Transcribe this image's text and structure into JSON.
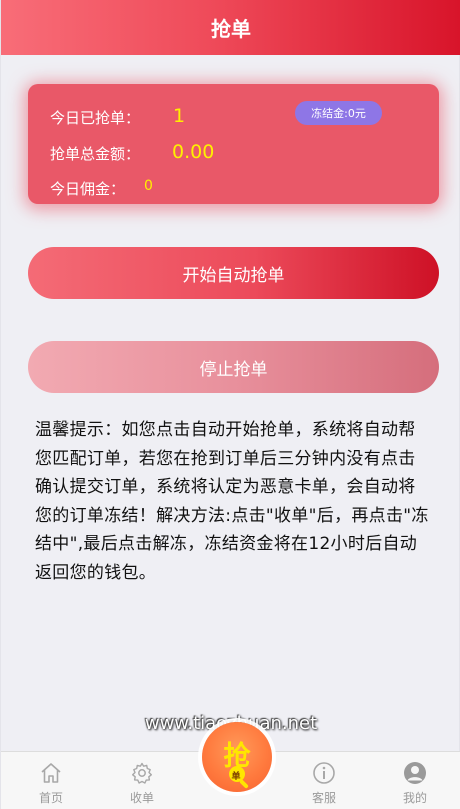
{
  "header": {
    "title": "抢单"
  },
  "stats": {
    "today_grabbed_label": "今日已抢单：",
    "today_grabbed_value": "1",
    "total_amount_label": "抢单总金额：",
    "total_amount_value": "0.00",
    "today_commission_label": "今日佣金：",
    "today_commission_value": "0",
    "frozen_badge": "冻结金:0元"
  },
  "buttons": {
    "start": "开始自动抢单",
    "stop": "停止抢单"
  },
  "tips": "温馨提示：如您点击自动开始抢单，系统将自动帮您匹配订单，若您在抢到订单后三分钟内没有点击确认提交订单，系统将认定为恶意卡单，会自动将您的订单冻结！解决方法:点击\"收单\"后，再点击\"冻结中\",最后点击解冻，冻结资金将在12小时后自动返回您的钱包。",
  "watermark": "www.tiaozhuan.net",
  "tabbar": {
    "home": "首页",
    "collect": "收单",
    "grab_big": "抢",
    "grab_small": "单",
    "service": "客服",
    "mine": "我的"
  },
  "colors": {
    "accent": "#ec4a5a",
    "accent_dark": "#d8142a",
    "value_yellow": "#fff000",
    "badge_purple": "#8e76e6",
    "grab_orange": "#ff7a3e"
  },
  "icons": {
    "home": "home-icon",
    "collect": "gear-icon",
    "grab": "magnifier-icon",
    "service": "info-icon",
    "mine": "user-icon"
  }
}
